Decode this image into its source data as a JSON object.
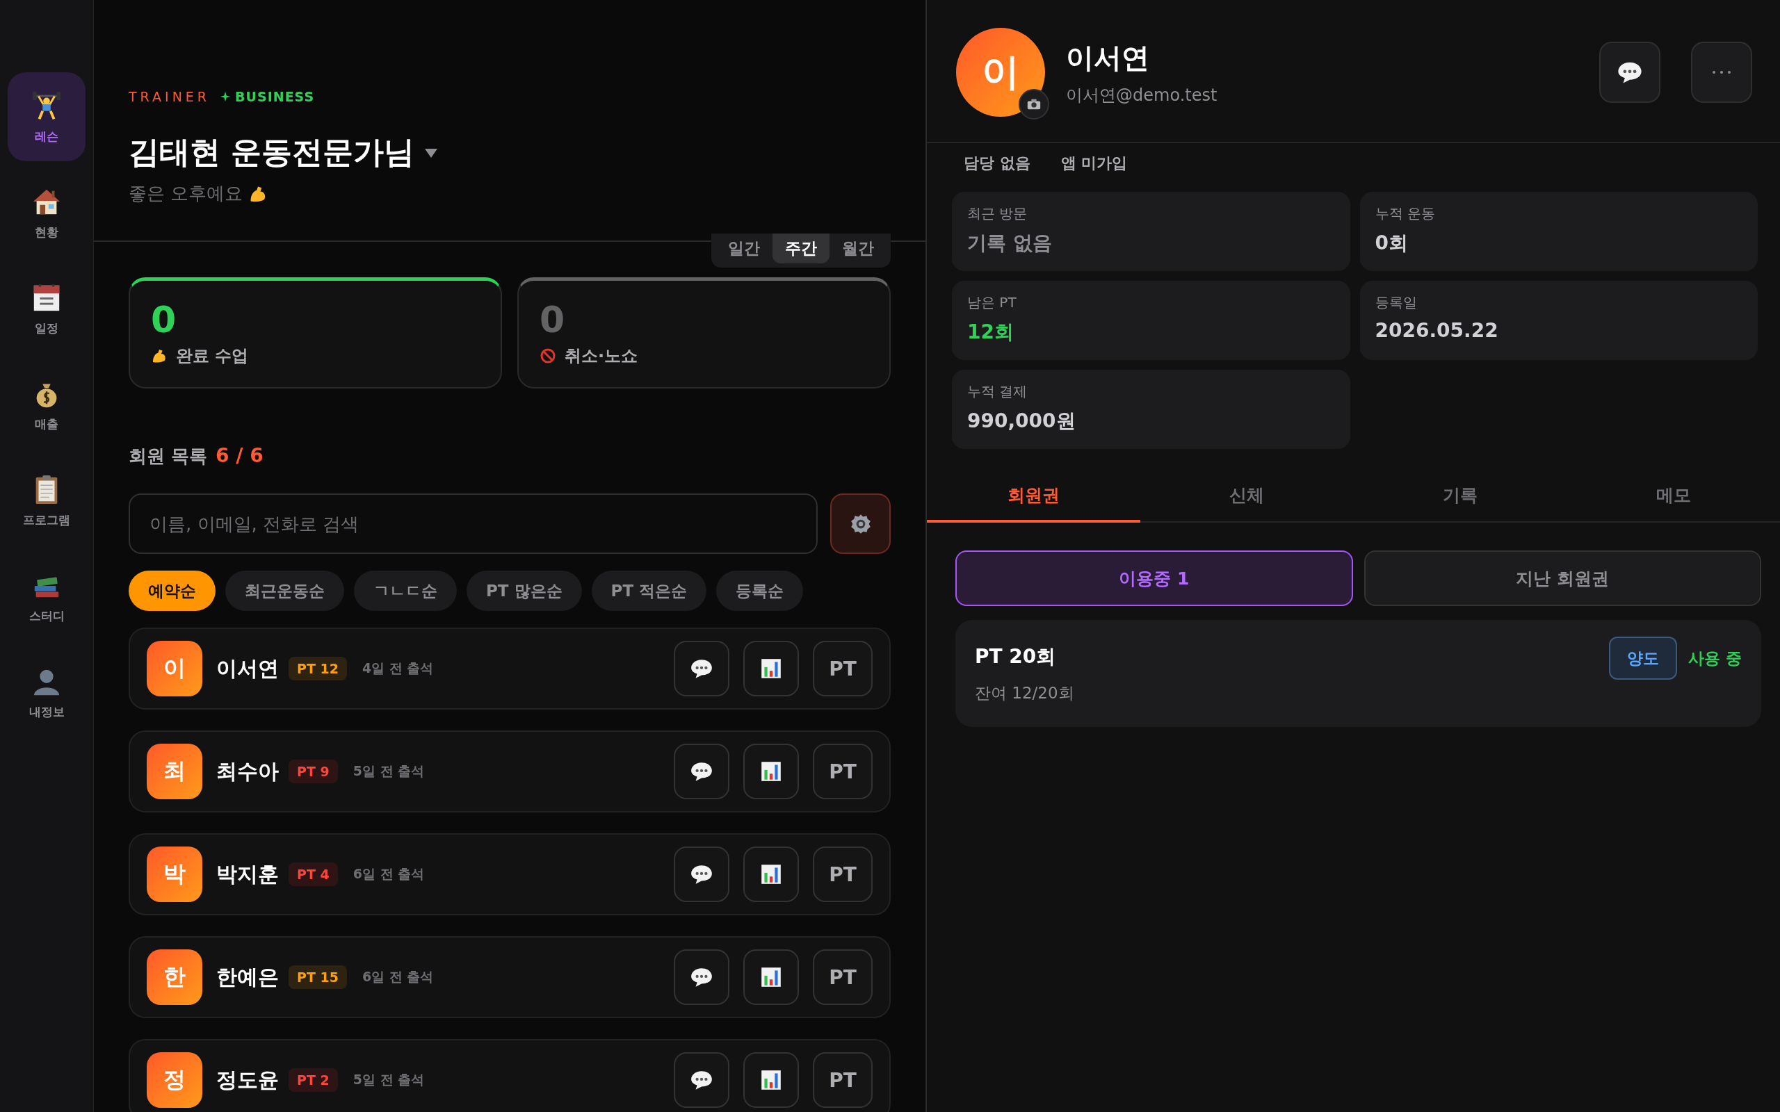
{
  "sidebar": {
    "items": [
      {
        "label": "레슨",
        "selected": true
      },
      {
        "label": "현황",
        "selected": false
      },
      {
        "label": "일정",
        "selected": false
      },
      {
        "label": "매출",
        "selected": false
      },
      {
        "label": "프로그램",
        "selected": false
      },
      {
        "label": "스터디",
        "selected": false
      },
      {
        "label": "내정보",
        "selected": false
      }
    ]
  },
  "header": {
    "eyebrow": "TRAINER",
    "badge": "BUSINESS",
    "title": "김태현 운동전문가님",
    "greeting": "좋은 오후예요"
  },
  "period_tabs": [
    {
      "label": "일간",
      "selected": false
    },
    {
      "label": "주간",
      "selected": true
    },
    {
      "label": "월간",
      "selected": false
    }
  ],
  "stats": [
    {
      "value": "0",
      "label": "완료 수업",
      "color": "#30d158"
    },
    {
      "value": "0",
      "label": "취소·노쇼",
      "color": "#636366"
    }
  ],
  "member_list": {
    "title": "회원 목록",
    "count": "6 / 6",
    "search": {
      "placeholder": "이름, 이메일, 전화로 검색"
    },
    "sort_chips": [
      {
        "label": "예약순",
        "selected": true
      },
      {
        "label": "최근운동순",
        "selected": false
      },
      {
        "label": "ㄱㄴㄷ순",
        "selected": false
      },
      {
        "label": "PT 많은순",
        "selected": false
      },
      {
        "label": "PT 적은순",
        "selected": false
      },
      {
        "label": "등록순",
        "selected": false
      }
    ],
    "members": [
      {
        "initial": "이",
        "name": "이서연",
        "pt": "PT 12",
        "kind": "high",
        "attendance": "4일 전 출석",
        "action": "PT"
      },
      {
        "initial": "최",
        "name": "최수아",
        "pt": "PT 9",
        "kind": "low",
        "attendance": "5일 전 출석",
        "action": "PT"
      },
      {
        "initial": "박",
        "name": "박지훈",
        "pt": "PT 4",
        "kind": "low",
        "attendance": "6일 전 출석",
        "action": "PT"
      },
      {
        "initial": "한",
        "name": "한예은",
        "pt": "PT 15",
        "kind": "high",
        "attendance": "6일 전 출석",
        "action": "PT"
      },
      {
        "initial": "정",
        "name": "정도윤",
        "pt": "PT 2",
        "kind": "low",
        "attendance": "5일 전 출석",
        "action": "PT"
      }
    ]
  },
  "profile": {
    "initial": "이",
    "name": "이서연",
    "email": "이서연@demo.test",
    "tags": [
      "담당 없음",
      "앱 미가입"
    ],
    "info": [
      {
        "label": "최근 방문",
        "value": "기록 없음",
        "kind": "muted"
      },
      {
        "label": "누적 운동",
        "value": "0회",
        "kind": "plain"
      },
      {
        "label": "남은 PT",
        "value": "12회",
        "kind": "accent"
      },
      {
        "label": "등록일",
        "value": "2026.05.22",
        "kind": "plain"
      },
      {
        "label": "누적 결제",
        "value": "990,000원",
        "kind": "plain"
      }
    ]
  },
  "detail_tabs": [
    {
      "label": "회원권",
      "selected": true
    },
    {
      "label": "신체",
      "selected": false
    },
    {
      "label": "기록",
      "selected": false
    },
    {
      "label": "메모",
      "selected": false
    }
  ],
  "membership_filter": [
    {
      "label": "이용중 1",
      "selected": true
    },
    {
      "label": "지난 회원권",
      "selected": false
    }
  ],
  "membership": {
    "title": "PT 20회",
    "remaining": "잔여 12/20회",
    "action": "양도",
    "status": "사용 중"
  }
}
